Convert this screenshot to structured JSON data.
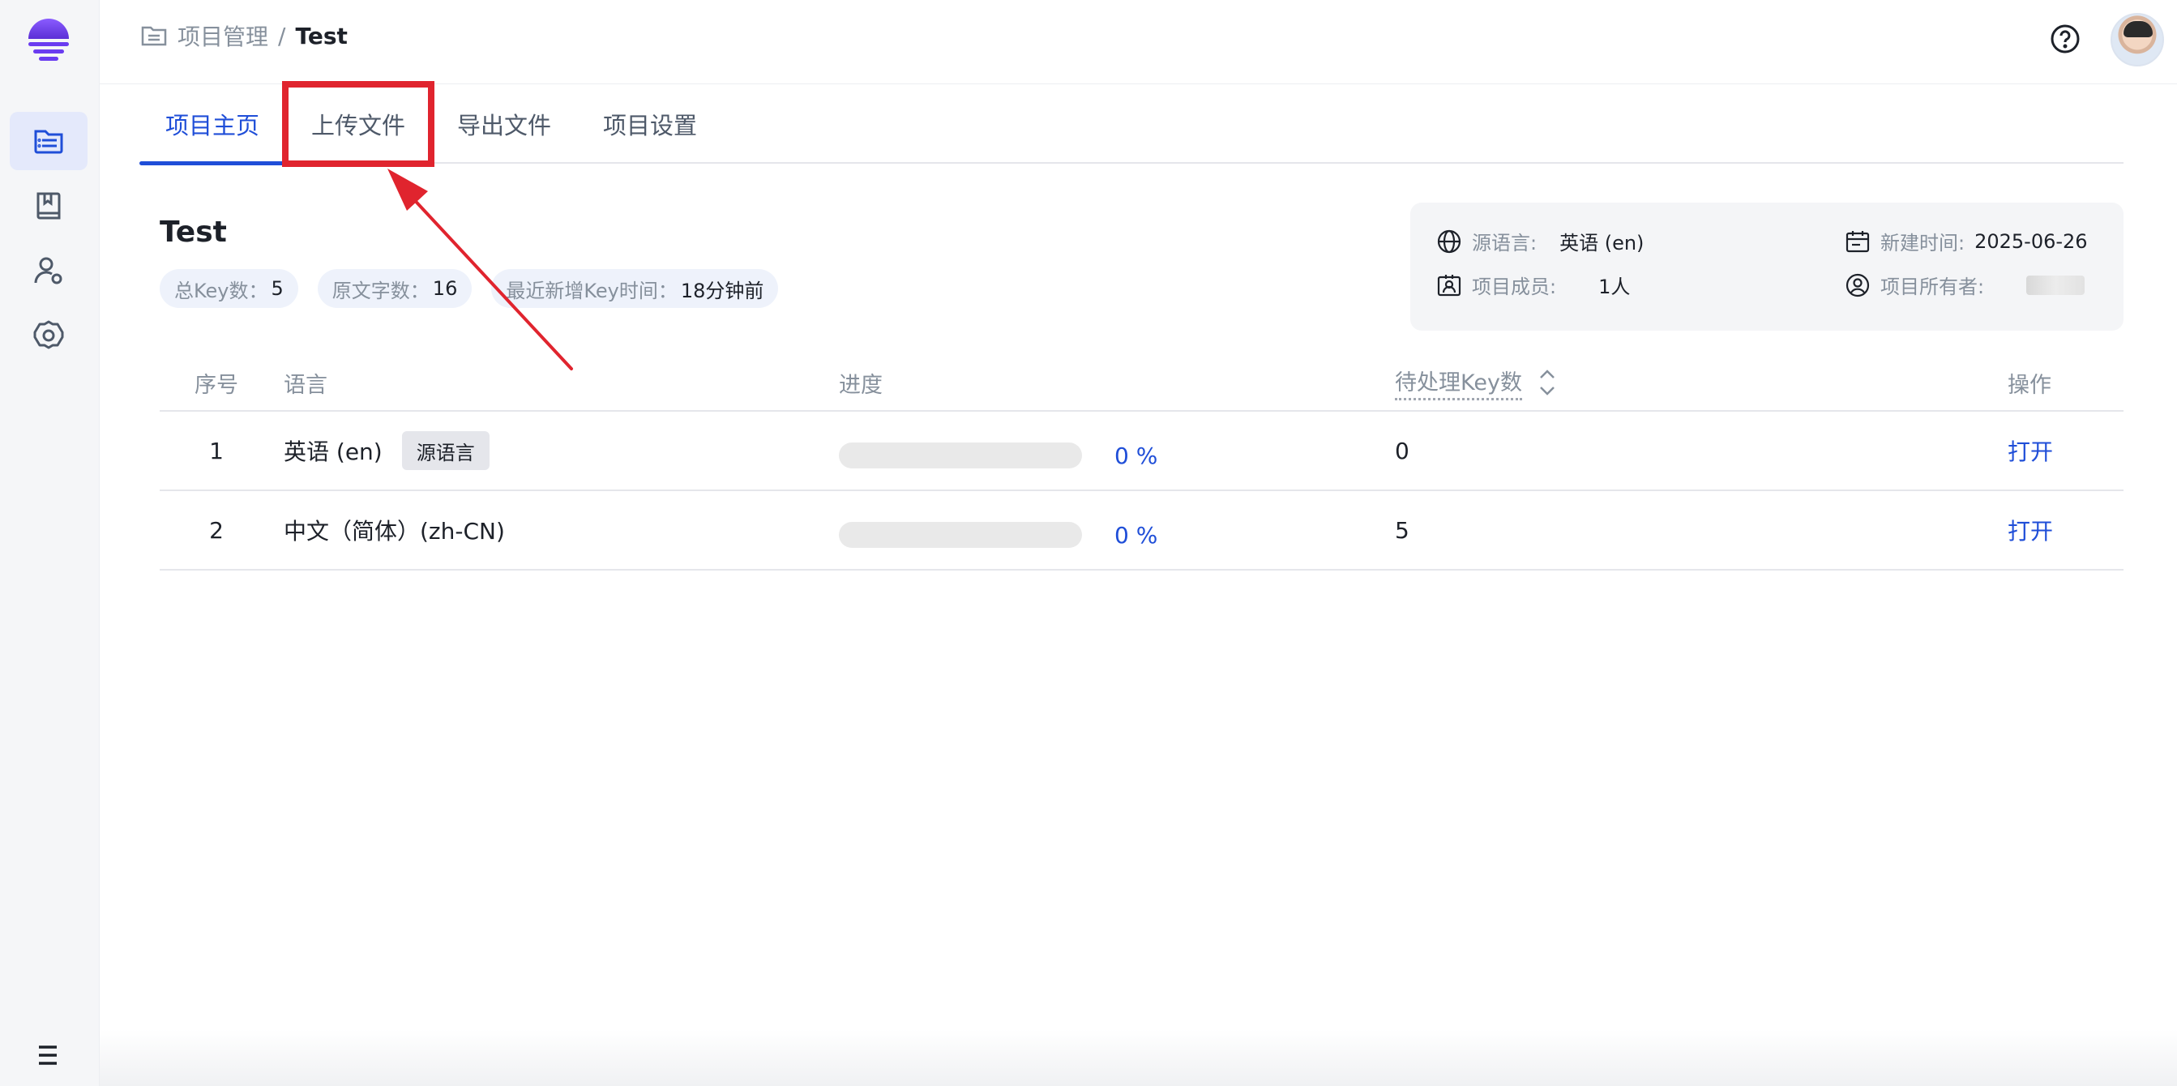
{
  "sidebar": {
    "logo": "app-logo",
    "items": [
      {
        "name": "project-list",
        "icon": "list-document-icon",
        "active": true
      },
      {
        "name": "glossary",
        "icon": "book-icon",
        "active": false
      },
      {
        "name": "members",
        "icon": "user-settings-icon",
        "active": false
      },
      {
        "name": "settings",
        "icon": "gear-icon",
        "active": false
      }
    ],
    "menu_icon": "hamburger-icon"
  },
  "header": {
    "breadcrumb": {
      "parent": "项目管理",
      "separator": "/",
      "current": "Test"
    },
    "help_icon": "question-circle-icon",
    "avatar": "user-avatar"
  },
  "tabs": [
    {
      "label": "项目主页",
      "active": true
    },
    {
      "label": "上传文件",
      "active": false,
      "highlighted": true
    },
    {
      "label": "导出文件",
      "active": false
    },
    {
      "label": "项目设置",
      "active": false
    }
  ],
  "project": {
    "title": "Test",
    "badges": [
      {
        "label": "总Key数：",
        "value": "5"
      },
      {
        "label": "原文字数：",
        "value": "16"
      },
      {
        "label": "最近新增Key时间：",
        "value": "18分钟前"
      }
    ]
  },
  "info": {
    "source_language": {
      "label": "源语言:",
      "value": "英语 (en)"
    },
    "created": {
      "label": "新建时间:",
      "value": "2025-06-26"
    },
    "members": {
      "label": "项目成员:",
      "value": "1人"
    },
    "owner": {
      "label": "项目所有者:",
      "value": ""
    }
  },
  "table": {
    "columns": {
      "index": "序号",
      "language": "语言",
      "progress": "进度",
      "pending": "待处理Key数",
      "actions": "操作"
    },
    "rows": [
      {
        "index": "1",
        "language": "英语 (en)",
        "tag": "源语言",
        "progress": 0,
        "progress_text": "0 %",
        "pending": "0",
        "action": "打开"
      },
      {
        "index": "2",
        "language": "中文（简体）(zh-CN)",
        "tag": "",
        "progress": 0,
        "progress_text": "0 %",
        "pending": "5",
        "action": "打开"
      }
    ]
  },
  "colors": {
    "accent": "#1f4ed8",
    "annotation": "#e0242e",
    "logo": "#6a3cf0"
  }
}
